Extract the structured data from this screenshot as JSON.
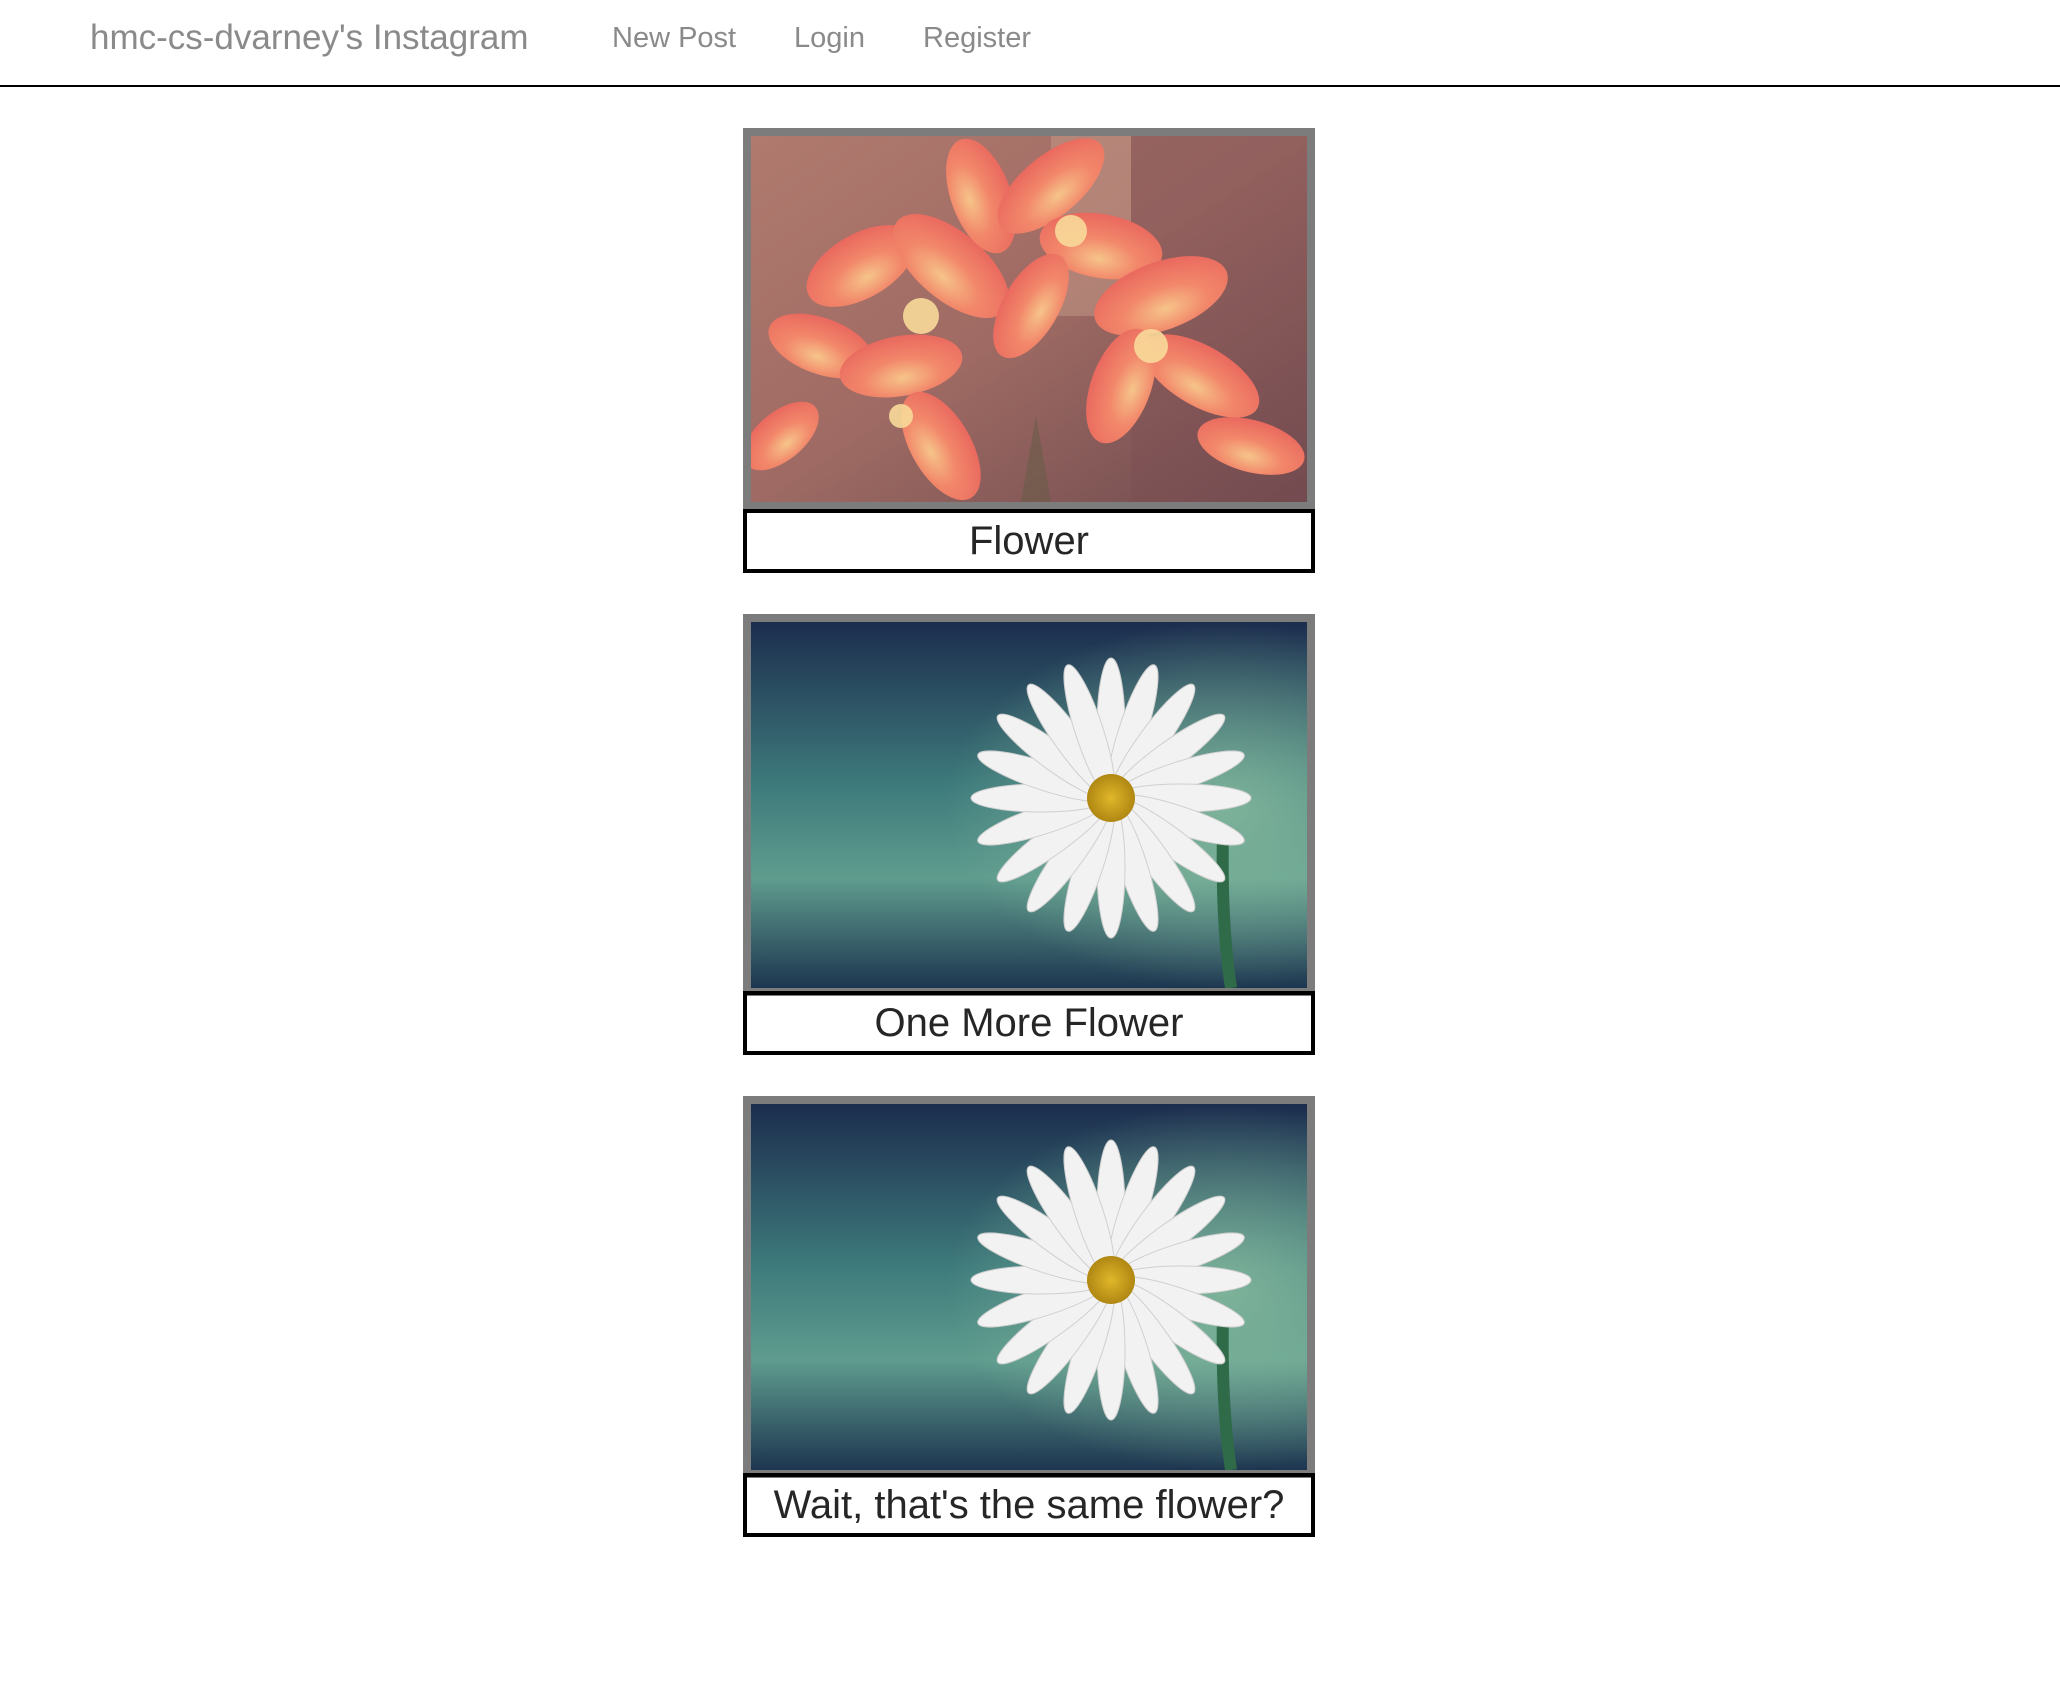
{
  "nav": {
    "brand": "hmc-cs-dvarney's Instagram",
    "links": [
      "New Post",
      "Login",
      "Register"
    ]
  },
  "posts": [
    {
      "caption": "Flower",
      "image": "salmon-flower-photo"
    },
    {
      "caption": "One More Flower",
      "image": "daisy-photo"
    },
    {
      "caption": "Wait, that's the same flower?",
      "image": "daisy-photo"
    }
  ]
}
